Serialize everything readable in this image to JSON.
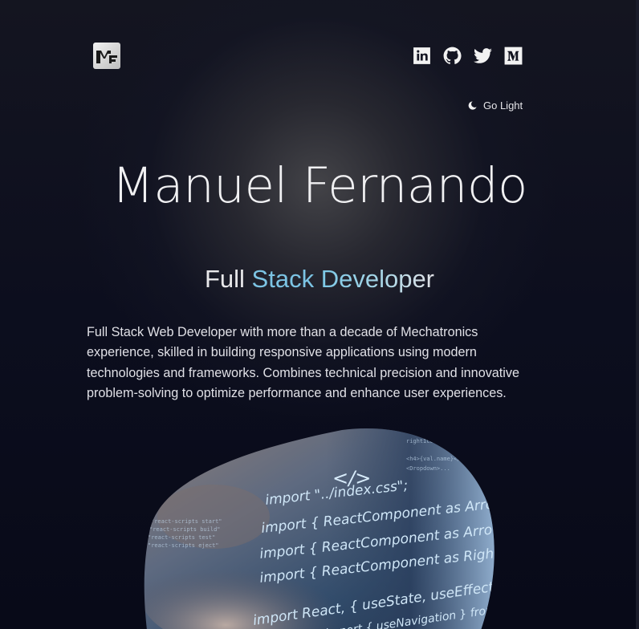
{
  "header": {
    "logo_alt": "MF",
    "socials": [
      {
        "name": "linkedin-icon",
        "label": "LinkedIn"
      },
      {
        "name": "github-icon",
        "label": "GitHub"
      },
      {
        "name": "twitter-icon",
        "label": "Twitter"
      },
      {
        "name": "medium-icon",
        "label": "Medium"
      }
    ],
    "theme_toggle_label": "Go Light"
  },
  "hero": {
    "name": "Manuel Fernando",
    "role_part1": "Full",
    "role_part2": "Stack",
    "role_part3": "Developer",
    "bio": "Full Stack Web Developer with more than a decade of Mechatronics experience, skilled in building responsive applications using modern technologies and frameworks. Combines technical precision and innovative problem-solving to optimize performance and enhance user experiences.",
    "image_code_lines": [
      "</>",
      "import \"../index.css\";",
      "import { ReactComponent as ArrowDown }",
      "import { ReactComponent as Arrow",
      "import { ReactComponent as Right",
      "import React, { useState, useEffect",
      "import { useNavigation } from"
    ]
  },
  "colors": {
    "background": "#0b0d1c",
    "accent": "#7cc4e4",
    "text": "#e8e8ec"
  }
}
